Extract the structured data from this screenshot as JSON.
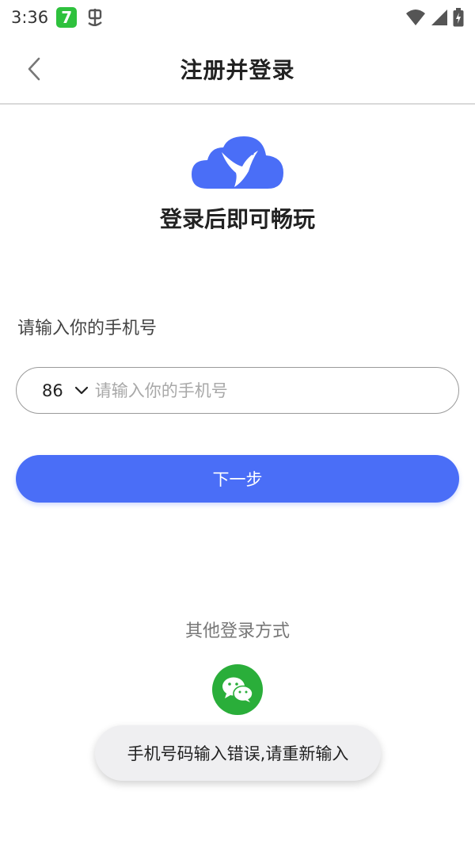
{
  "status_bar": {
    "time": "3:36",
    "app_icon_label": "7",
    "icons": [
      "app-seven-icon",
      "bug-icon",
      "wifi-icon",
      "signal-icon",
      "battery-charging-icon"
    ]
  },
  "header": {
    "title": "注册并登录",
    "back_icon": "chevron-left-icon"
  },
  "brand": {
    "logo_icon": "cloud-bird-logo-icon",
    "slogan": "登录后即可畅玩",
    "color": "#4a6ef7"
  },
  "form": {
    "phone_label": "请输入你的手机号",
    "country_code": "86",
    "phone_value": "",
    "phone_placeholder": "请输入你的手机号",
    "next_button_label": "下一步",
    "accent_color": "#4a6ef7"
  },
  "other_login": {
    "title": "其他登录方式",
    "wechat_icon": "wechat-icon",
    "wechat_color": "#2aae3a"
  },
  "toast": {
    "message": "手机号码输入错误,请重新输入"
  }
}
